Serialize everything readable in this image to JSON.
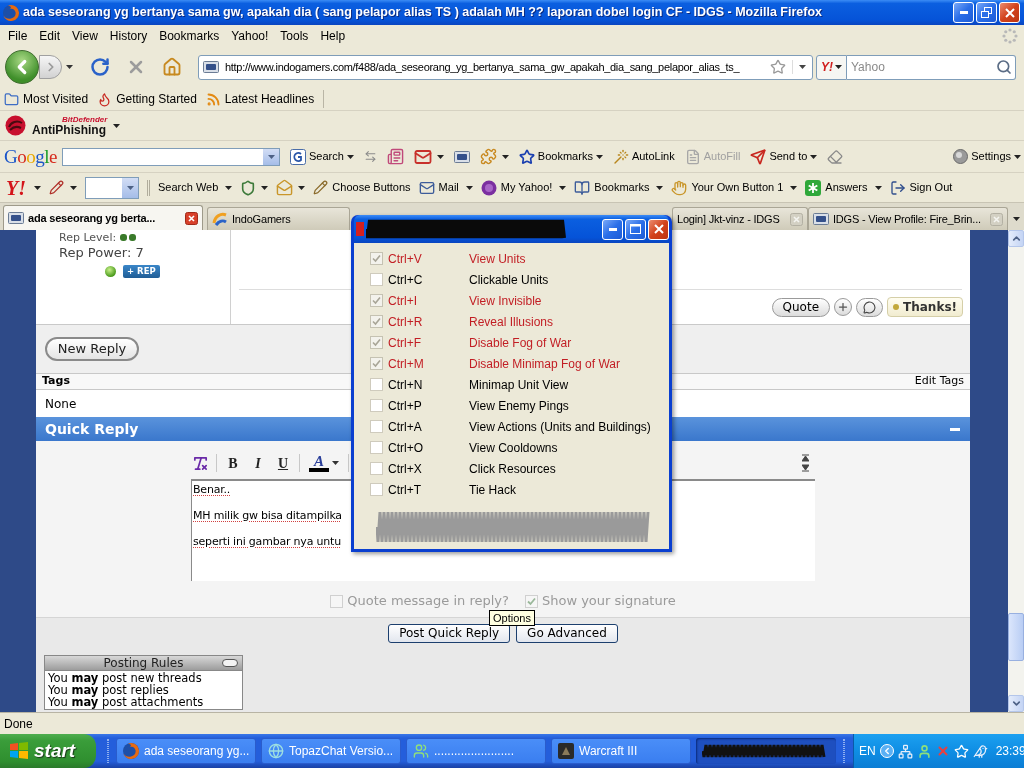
{
  "window": {
    "title": "ada seseorang yg bertanya sama gw, apakah dia ( sang pelapor alias TS ) adalah MH ?? laporan dobel login CF - IDGS - Mozilla Firefox"
  },
  "menu": [
    "File",
    "Edit",
    "View",
    "History",
    "Bookmarks",
    "Yahoo!",
    "Tools",
    "Help"
  ],
  "navigation": {
    "url": "http://www.indogamers.com/f488/ada_seseorang_yg_bertanya_sama_gw_apakah_dia_sang_pelapor_alias_ts_",
    "search_engine": "Y!",
    "search_placeholder": "Yahoo"
  },
  "bookmarks_toolbar": [
    "Most Visited",
    "Getting Started",
    "Latest Headlines"
  ],
  "antiphishing_toolbar": {
    "brand": "BitDefender",
    "label": "AntiPhishing"
  },
  "google_toolbar": {
    "logo": "Google",
    "items": [
      {
        "label": "Search",
        "dropdown": true,
        "disabled": false
      },
      {
        "label": "Bookmarks",
        "dropdown": true,
        "disabled": false
      },
      {
        "label": "AutoLink",
        "dropdown": false,
        "disabled": false
      },
      {
        "label": "AutoFill",
        "dropdown": false,
        "disabled": true
      },
      {
        "label": "Send to",
        "dropdown": true,
        "disabled": false
      }
    ],
    "settings": {
      "label": "Settings",
      "dropdown": true
    }
  },
  "yahoo_toolbar": {
    "logo": "Y!",
    "items": [
      {
        "label": "Search Web",
        "dropdown": true
      },
      {
        "label": "Choose Buttons",
        "dropdown": false
      },
      {
        "label": "Mail",
        "dropdown": true
      },
      {
        "label": "My Yahoo!",
        "dropdown": true
      },
      {
        "label": "Bookmarks",
        "dropdown": true
      },
      {
        "label": "Your Own Button 1",
        "dropdown": true
      },
      {
        "label": "Answers",
        "dropdown": true
      },
      {
        "label": "Sign Out",
        "dropdown": false
      }
    ]
  },
  "tabs": [
    {
      "label": "ada seseorang yg berta...",
      "selected": true,
      "closable": true
    },
    {
      "label": "IndoGamers",
      "selected": false,
      "closable": false
    },
    {
      "label": "Login] Jkt-vinz - IDGS",
      "selected": false,
      "closable": true
    },
    {
      "label": "IDGS - View Profile: Fire_Brin...",
      "selected": false,
      "closable": true
    }
  ],
  "post": {
    "rep_level": "Rep Level:",
    "rep_power": "Rep Power: 7",
    "online": true,
    "rep_button": "+ REP",
    "quote": "Quote",
    "thanks": "Thanks!"
  },
  "new_reply": "New Reply",
  "tags": {
    "heading": "Tags",
    "edit": "Edit Tags",
    "value": "None"
  },
  "quick_reply": {
    "title": "Quick Reply",
    "format_buttons": [
      {
        "kind": "bold",
        "label": "B"
      },
      {
        "kind": "italic",
        "label": "I"
      },
      {
        "kind": "underline",
        "label": "U"
      },
      {
        "kind": "color",
        "label": "A"
      }
    ],
    "lines": [
      "Benar..",
      "MH milik gw bisa ditampilka",
      "seperti ini gambar nya untu"
    ],
    "options": [
      {
        "label": "Quote message in reply?",
        "checked": false,
        "disabled": true
      },
      {
        "label": "Show your signature",
        "checked": true,
        "disabled": true
      }
    ],
    "buttons": [
      "Post Quick Reply",
      "Go Advanced"
    ],
    "tooltip": "Options"
  },
  "posting_rules": {
    "title": "Posting Rules",
    "lines": [
      "You **may** post new threads",
      "You **may** post replies",
      "You **may** post attachments"
    ]
  },
  "trainer_window": {
    "rows": [
      {
        "shortcut": "Ctrl+V",
        "label": "View Units",
        "checked": true
      },
      {
        "shortcut": "Ctrl+C",
        "label": "Clickable Units",
        "checked": false
      },
      {
        "shortcut": "Ctrl+I",
        "label": "View Invisible",
        "checked": true
      },
      {
        "shortcut": "Ctrl+R",
        "label": "Reveal Illusions",
        "checked": true
      },
      {
        "shortcut": "Ctrl+F",
        "label": "Disable Fog of War",
        "checked": true
      },
      {
        "shortcut": "Ctrl+M",
        "label": "Disable Minimap Fog of War",
        "checked": true
      },
      {
        "shortcut": "Ctrl+N",
        "label": "Minimap Unit View",
        "checked": false
      },
      {
        "shortcut": "Ctrl+P",
        "label": "View Enemy Pings",
        "checked": false
      },
      {
        "shortcut": "Ctrl+A",
        "label": "View Actions (Units and Buildings)",
        "checked": false
      },
      {
        "shortcut": "Ctrl+O",
        "label": "View Cooldowns",
        "checked": false
      },
      {
        "shortcut": "Ctrl+X",
        "label": "Click Resources",
        "checked": false
      },
      {
        "shortcut": "Ctrl+T",
        "label": "Tie Hack",
        "checked": false
      }
    ]
  },
  "status_bar": {
    "text": "Done"
  },
  "taskbar": {
    "start": "start",
    "tasks": [
      {
        "kind": "app",
        "label": "ada seseorang yg...",
        "selected": false
      },
      {
        "kind": "app",
        "label": "TopazChat Versio...",
        "selected": false
      },
      {
        "kind": "app",
        "label": "........................",
        "selected": false
      },
      {
        "kind": "app",
        "label": "Warcraft III",
        "selected": false
      },
      {
        "kind": "redacted",
        "selected": true
      }
    ],
    "language": "EN",
    "clock": "23:39"
  }
}
